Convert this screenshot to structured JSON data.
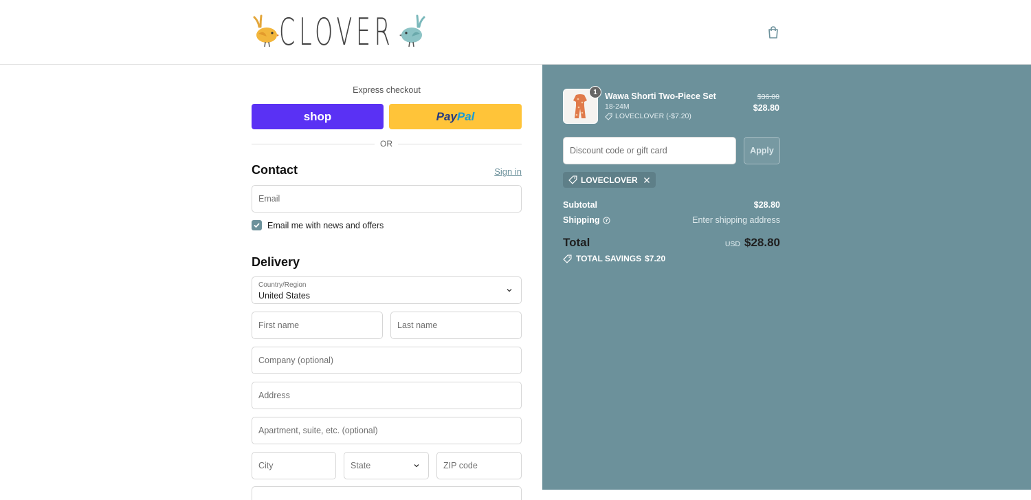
{
  "header": {
    "logo_text": "CLOVER",
    "bag_icon": "shopping-bag-icon"
  },
  "express": {
    "label": "Express checkout",
    "shop_label": "shop",
    "paypal_a": "Pay",
    "paypal_b": "Pal",
    "or_label": "OR"
  },
  "contact": {
    "heading": "Contact",
    "signin": "Sign in",
    "email_placeholder": "Email",
    "newsletter_label": "Email me with news and offers",
    "newsletter_checked": true
  },
  "delivery": {
    "heading": "Delivery",
    "country_label": "Country/Region",
    "country_value": "United States",
    "first_name": "First name",
    "last_name": "Last name",
    "company": "Company (optional)",
    "address": "Address",
    "apartment": "Apartment, suite, etc. (optional)",
    "city": "City",
    "state": "State",
    "zip": "ZIP code"
  },
  "order": {
    "item": {
      "name": "Wawa Shorti Two-Piece Set",
      "variant": "18-24M",
      "discount": "LOVECLOVER (-$7.20)",
      "quantity": "1",
      "price_original": "$36.00",
      "price_final": "$28.80"
    },
    "discount_placeholder": "Discount code or gift card",
    "apply_label": "Apply",
    "applied_code": "LOVECLOVER",
    "subtotal_label": "Subtotal",
    "subtotal_value": "$28.80",
    "shipping_label": "Shipping",
    "shipping_value": "Enter shipping address",
    "total_label": "Total",
    "currency": "USD",
    "total_value": "$28.80",
    "savings_label": "TOTAL SAVINGS",
    "savings_value": "$7.20"
  },
  "colors": {
    "accent": "#6c919b",
    "shop": "#5a31f4",
    "paypal": "#ffc439"
  }
}
